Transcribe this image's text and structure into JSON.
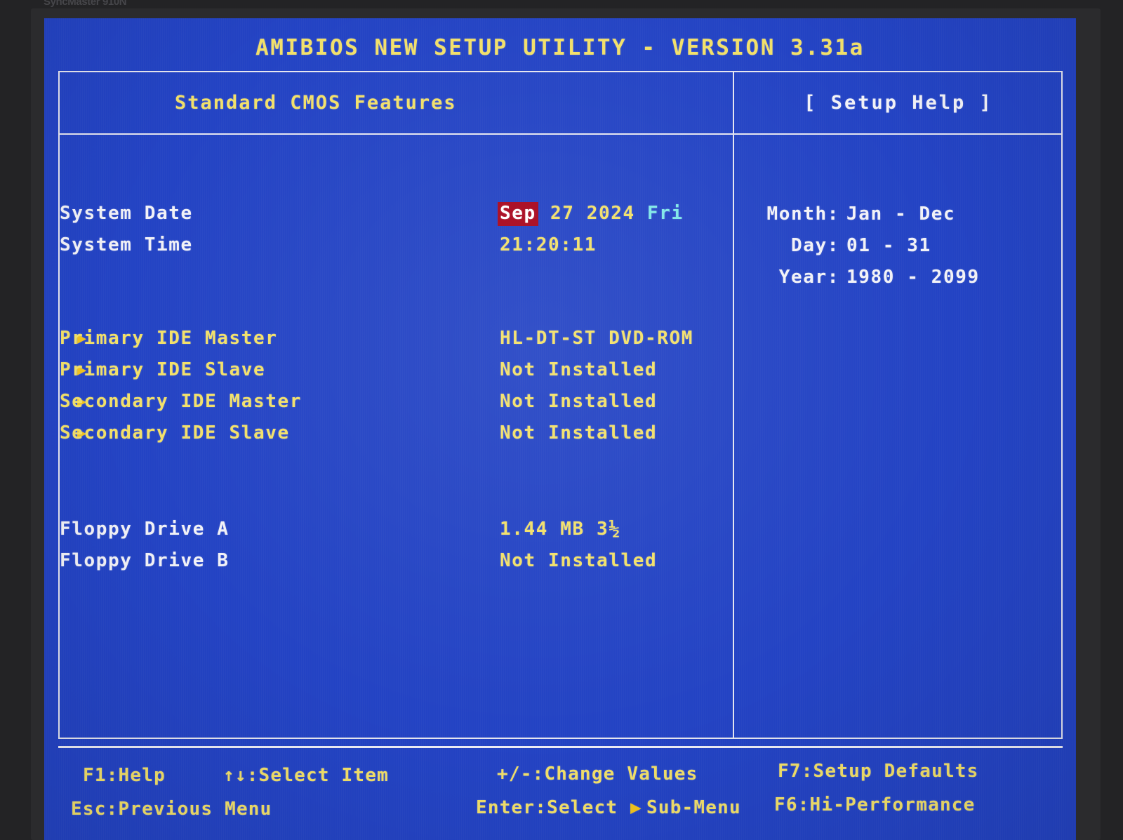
{
  "monitor": {
    "bezel_label": "SyncMaster 910N"
  },
  "screen": {
    "title": "AMIBIOS NEW SETUP UTILITY - VERSION 3.31a",
    "section_title": "Standard CMOS Features",
    "help_panel_title": "[ Setup Help ]",
    "colors": {
      "background": "#2343c4",
      "border": "#e6e6f0",
      "yellow_text": "#f2e06a",
      "white_text": "#f2f2f7",
      "cyan_text": "#7fe8e8",
      "highlight_bg": "#a8071e",
      "highlight_fg": "#ffffff",
      "bullet": "#f2c31e"
    }
  },
  "settings": [
    {
      "name": "system-date",
      "label": "System Date",
      "label_color": "white",
      "bullet": false,
      "value_parts": [
        {
          "text": "Sep",
          "style": "highlight"
        },
        {
          "text": " 27 2024 ",
          "style": "yellow"
        },
        {
          "text": "Fri",
          "style": "cyan"
        }
      ]
    },
    {
      "name": "system-time",
      "label": "System Time",
      "label_color": "white",
      "bullet": false,
      "value_parts": [
        {
          "text": "21:20:11",
          "style": "yellow"
        }
      ]
    },
    {
      "name": "primary-ide-master",
      "label": "Primary IDE Master",
      "label_color": "yellow",
      "bullet": true,
      "value_parts": [
        {
          "text": "HL-DT-ST DVD-ROM",
          "style": "yellow"
        }
      ]
    },
    {
      "name": "primary-ide-slave",
      "label": "Primary IDE Slave",
      "label_color": "yellow",
      "bullet": true,
      "value_parts": [
        {
          "text": "Not Installed",
          "style": "yellow"
        }
      ]
    },
    {
      "name": "secondary-ide-master",
      "label": "Secondary IDE Master",
      "label_color": "yellow",
      "bullet": true,
      "value_parts": [
        {
          "text": "Not Installed",
          "style": "yellow"
        }
      ]
    },
    {
      "name": "secondary-ide-slave",
      "label": "Secondary IDE Slave",
      "label_color": "yellow",
      "bullet": true,
      "value_parts": [
        {
          "text": "Not Installed",
          "style": "yellow"
        }
      ]
    },
    {
      "name": "floppy-drive-a",
      "label": "Floppy Drive A",
      "label_color": "white",
      "bullet": false,
      "value_parts": [
        {
          "text": "1.44 MB 3½",
          "style": "yellow"
        }
      ]
    },
    {
      "name": "floppy-drive-b",
      "label": "Floppy Drive B",
      "label_color": "white",
      "bullet": false,
      "value_parts": [
        {
          "text": "Not Installed",
          "style": "yellow"
        }
      ]
    }
  ],
  "help": {
    "rows": [
      {
        "name": "help-month",
        "key": "Month:",
        "value": "Jan - Dec"
      },
      {
        "name": "help-day",
        "key": "Day:",
        "value": "01 - 31"
      },
      {
        "name": "help-year",
        "key": "Year:",
        "value": "1980 - 2099"
      }
    ]
  },
  "footer": {
    "items": [
      {
        "name": "footer-f1-help",
        "text": "F1:Help"
      },
      {
        "name": "footer-select-item",
        "text": "↑↓:Select Item"
      },
      {
        "name": "footer-change-values",
        "text": "+/-:Change Values"
      },
      {
        "name": "footer-setup-defaults",
        "text": "F7:Setup Defaults"
      },
      {
        "name": "footer-previous-menu",
        "text": "Esc:Previous Menu"
      },
      {
        "name": "footer-enter-select",
        "text": "Enter:Select "
      },
      {
        "name": "footer-sub-menu-arrow",
        "text": "▶"
      },
      {
        "name": "footer-sub-menu",
        "text": "Sub-Menu"
      },
      {
        "name": "footer-hi-performance",
        "text": "F6:Hi-Performance"
      }
    ]
  }
}
